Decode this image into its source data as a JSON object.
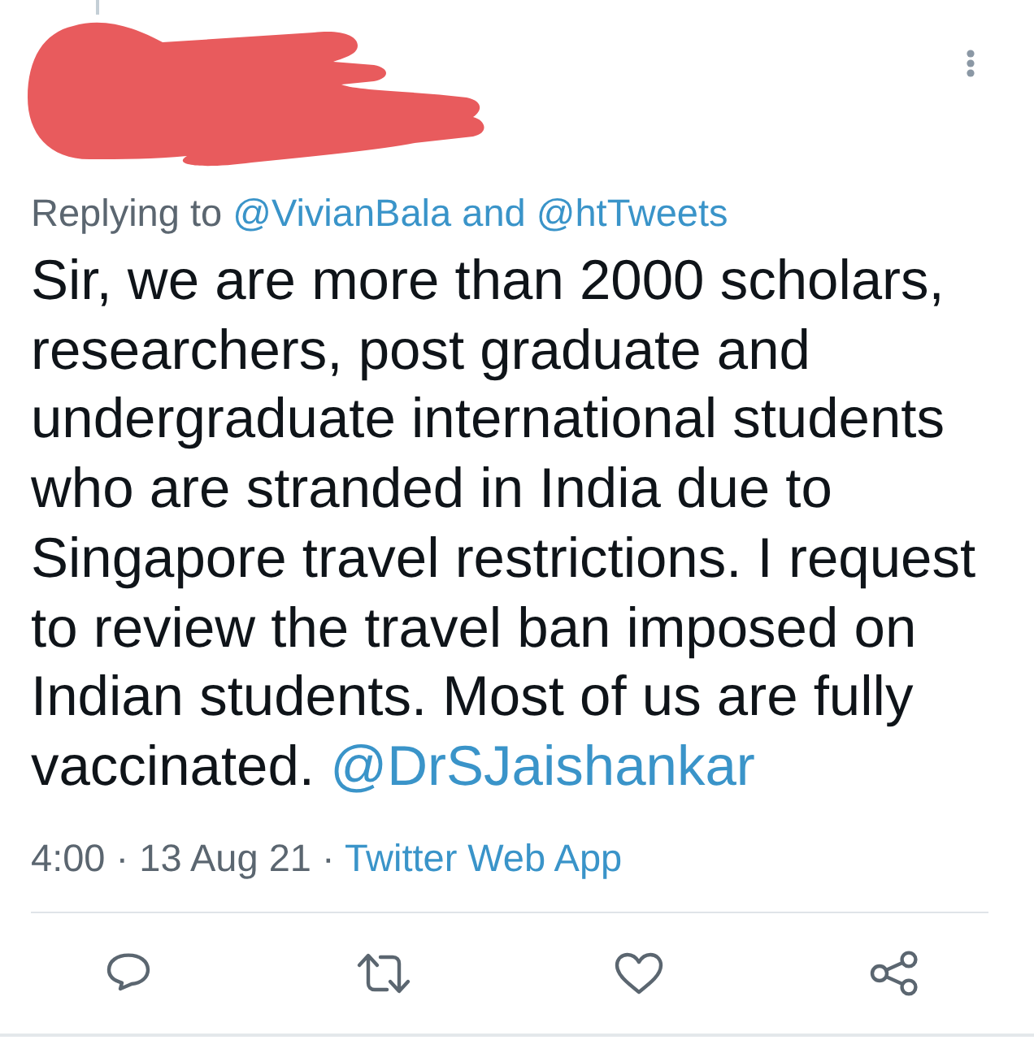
{
  "tweet": {
    "replying_to": {
      "label": "Replying to",
      "handles": [
        "@VivianBala",
        "@htTweets"
      ],
      "joiner": "and"
    },
    "body": {
      "text": "Sir, we are more than 2000 scholars, researchers, post graduate and undergraduate international students who are stranded in India due to Singapore travel restrictions. I request to review the travel ban imposed on Indian students. Most of us are fully vaccinated.",
      "mention": "@DrSJaishankar"
    },
    "meta": {
      "text": "4:00 · 13 Aug 21 ·",
      "source": "Twitter Web App"
    }
  }
}
